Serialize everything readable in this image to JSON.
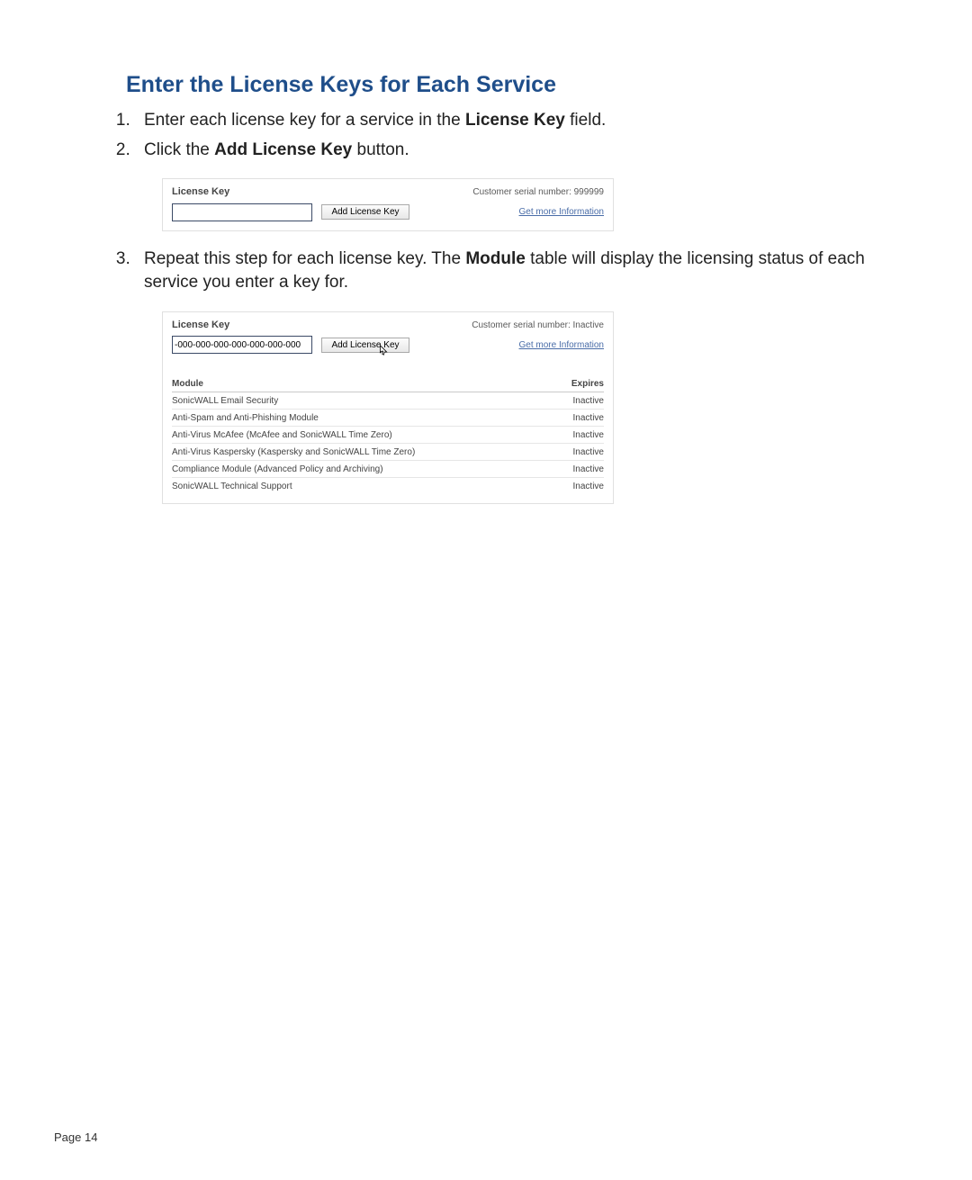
{
  "heading": "Enter the License Keys for Each Service",
  "steps": {
    "s1": {
      "pre": "Enter each license key for a service in the ",
      "bold": "License Key",
      "post": " field."
    },
    "s2": {
      "pre": "Click the ",
      "bold": "Add License Key",
      "post": " button."
    },
    "s3": {
      "pre": "Repeat this step for each license key. The ",
      "bold": "Module",
      "post": " table will display the licensing status of each service you enter a key for."
    }
  },
  "panel1": {
    "license_key_label": "License Key",
    "serial_label": "Customer serial number: ",
    "serial_value": "999999",
    "input_value": "",
    "button_label": "Add License Key",
    "more_info": "Get more Information"
  },
  "panel2": {
    "license_key_label": "License Key",
    "serial_label": "Customer serial number: ",
    "serial_value": "Inactive",
    "input_value": "-000-000-000-000-000-000-000",
    "button_label": "Add License Key",
    "more_info": "Get more Information",
    "table": {
      "col_module": "Module",
      "col_expires": "Expires",
      "rows": [
        {
          "module": "SonicWALL Email Security",
          "expires": "Inactive"
        },
        {
          "module": "Anti-Spam and Anti-Phishing Module",
          "expires": "Inactive"
        },
        {
          "module": "Anti-Virus McAfee (McAfee and SonicWALL Time Zero)",
          "expires": "Inactive"
        },
        {
          "module": "Anti-Virus Kaspersky (Kaspersky and SonicWALL Time Zero)",
          "expires": "Inactive"
        },
        {
          "module": "Compliance Module (Advanced Policy and Archiving)",
          "expires": "Inactive"
        },
        {
          "module": "SonicWALL Technical Support",
          "expires": "Inactive"
        }
      ]
    }
  },
  "footer": "Page 14"
}
